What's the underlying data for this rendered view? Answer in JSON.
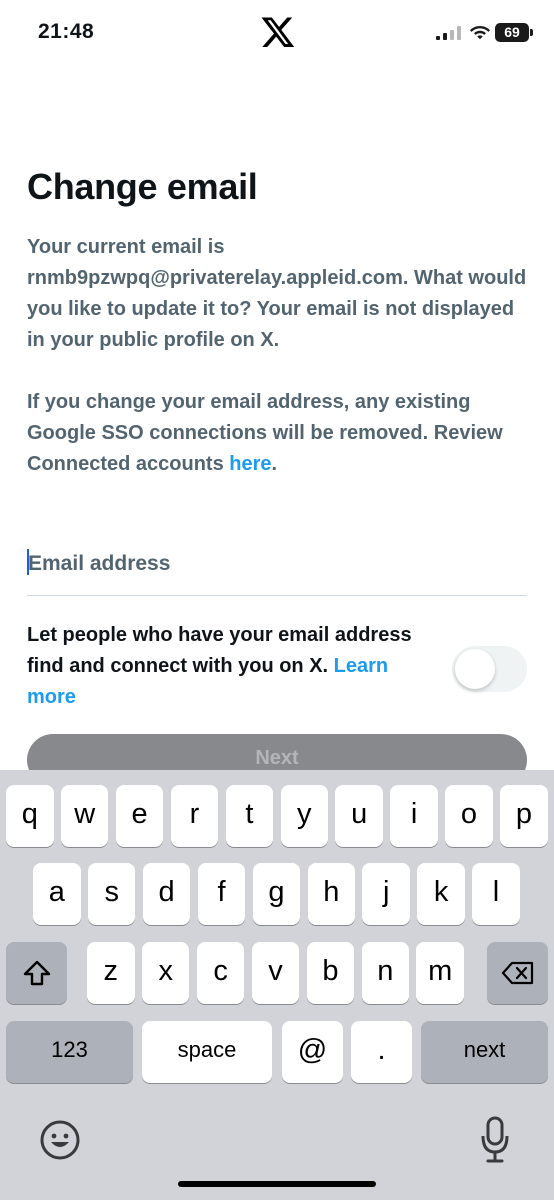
{
  "status_bar": {
    "time": "21:48",
    "battery": "69"
  },
  "page": {
    "title": "Change email",
    "description_1": "Your current email is rnmb9pzwpq@privaterelay.appleid.com. What would you like to update it to? Your email is not displayed in your public profile on X.",
    "description_2_prefix": "If you change your email address, any existing Google SSO connections will be removed. Review Connected accounts ",
    "description_2_link": "here",
    "description_2_suffix": "."
  },
  "email_input": {
    "placeholder": "Email address",
    "value": ""
  },
  "discover": {
    "text": "Let people who have your email address find and connect with you on X. ",
    "link": "Learn more",
    "toggle_on": false
  },
  "next_button": {
    "label": "Next",
    "enabled": false
  },
  "keyboard": {
    "row1": [
      "q",
      "w",
      "e",
      "r",
      "t",
      "y",
      "u",
      "i",
      "o",
      "p"
    ],
    "row2": [
      "a",
      "s",
      "d",
      "f",
      "g",
      "h",
      "j",
      "k",
      "l"
    ],
    "row3": [
      "z",
      "x",
      "c",
      "v",
      "b",
      "n",
      "m"
    ],
    "numbers_label": "123",
    "space_label": "space",
    "at_label": "@",
    "dot_label": ".",
    "next_label": "next",
    "icons": [
      "shift-icon",
      "backspace-icon",
      "emoji-icon",
      "microphone-icon"
    ]
  },
  "colors": {
    "accent": "#1d9bf0",
    "secondary_text": "#536471",
    "keyboard_bg": "#d1d3d9"
  }
}
